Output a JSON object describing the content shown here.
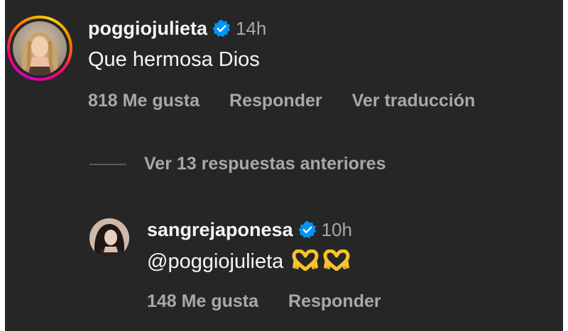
{
  "comments": [
    {
      "username": "poggiojulieta",
      "time": "14h",
      "text": "Que hermosa Dios",
      "likes_label": "818 Me gusta",
      "reply_label": "Responder",
      "translate_label": "Ver traducción",
      "has_story_ring": true,
      "verified_icon": "verified-badge-icon"
    }
  ],
  "replies_toggle": {
    "label": "Ver 13 respuestas anteriores"
  },
  "replies": [
    {
      "username": "sangrejaponesa",
      "time": "10h",
      "mention": "@poggiojulieta",
      "emojis": [
        "heart-hands-icon",
        "heart-hands-icon"
      ],
      "likes_label": "148 Me gusta",
      "reply_label": "Responder",
      "verified_icon": "verified-badge-icon"
    }
  ],
  "colors": {
    "background": "#262626",
    "primary_text": "#f5f5f5",
    "secondary_text": "#a8a8a8",
    "verified_blue": "#0095f6",
    "emoji_yellow": "#f6c32c"
  }
}
